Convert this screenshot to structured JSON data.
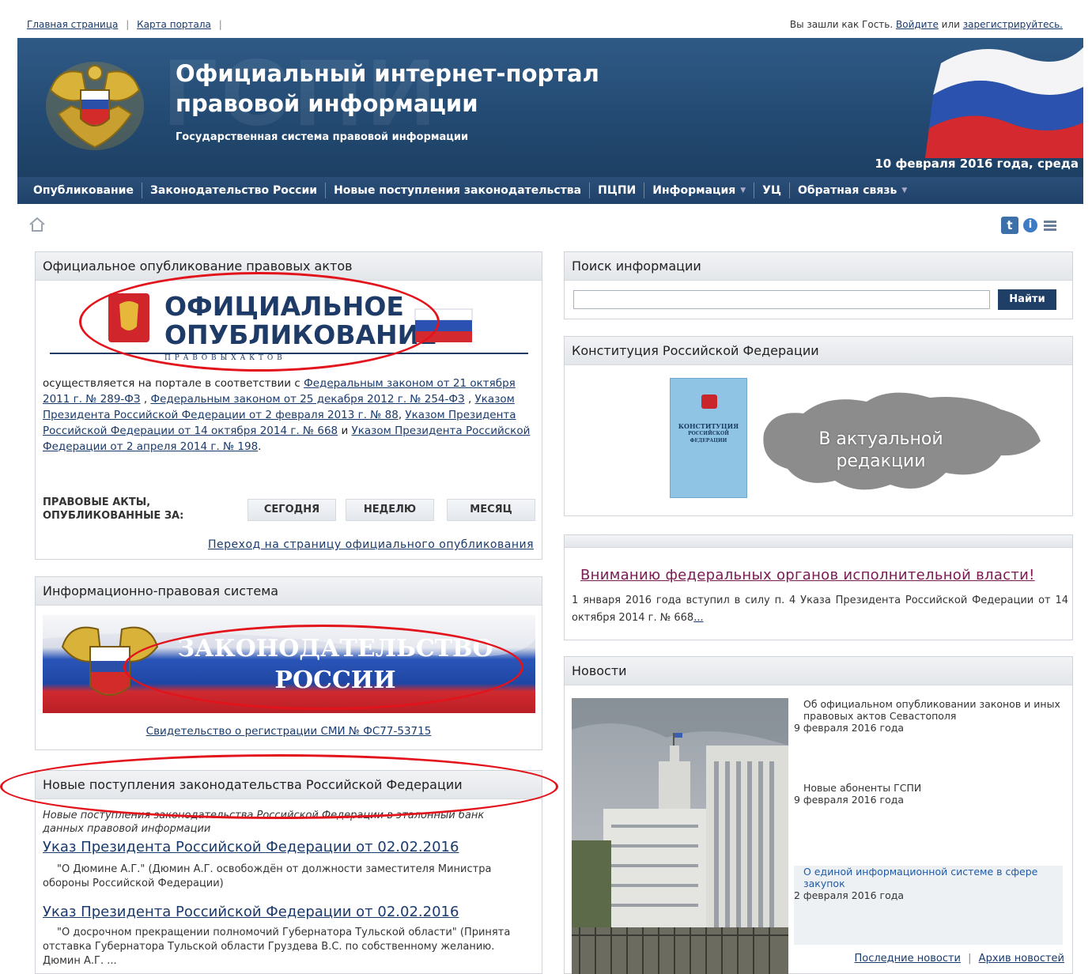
{
  "topbar": {
    "home_link": "Главная страница",
    "map_link": "Карта портала",
    "separator": "|",
    "guest_prefix": "Вы зашли как Гость.",
    "login_link": "Войдите",
    "or_text": "или",
    "register_link": "зарегистрируйтесь."
  },
  "header": {
    "watermark": "ГСПИ",
    "title_line1": "Официальный интернет-портал",
    "title_line2": "правовой информации",
    "subtitle": "Государственная система правовой информации",
    "date": "10 февраля 2016 года, среда"
  },
  "nav": {
    "items": [
      {
        "label": "Опубликование",
        "dropdown": false
      },
      {
        "label": "Законодательство России",
        "dropdown": false
      },
      {
        "label": "Новые поступления законодательства",
        "dropdown": false
      },
      {
        "label": "ПЦПИ",
        "dropdown": false
      },
      {
        "label": "Информация",
        "dropdown": true
      },
      {
        "label": "УЦ",
        "dropdown": false
      },
      {
        "label": "Обратная связь",
        "dropdown": true
      }
    ]
  },
  "toolbar": {
    "twitter_glyph": "t",
    "info_glyph": "i"
  },
  "pub_panel": {
    "heading": "Официальное опубликование правовых актов",
    "logo_line1": "ОФИЦИАЛЬНОЕ",
    "logo_line2": "ОПУБЛИКОВАНИЕ",
    "logo_line3": "П Р А В О В Ы Х   А К Т О В",
    "text_prefix": "осуществляется на портале в соответствии с ",
    "link1": "Федеральным законом от 21 октября 2011 г. № 289-ФЗ",
    "sep1": " , ",
    "link2": "Федеральным законом от 25 декабря 2012 г. № 254-ФЗ",
    "sep2": " , ",
    "link3": "Указом Президента Российской Федерации от 2 февраля 2013 г. № 88",
    "sep3": ", ",
    "link4": "Указом Президента Российской Федерации от 14 октября 2014 г. № 668",
    "sep4": " и ",
    "link5": "Указом Президента Российской Федерации от 2 апреля 2014 г. № 198",
    "text_suffix": ".",
    "acts_label_line1": "ПРАВОВЫЕ АКТЫ,",
    "acts_label_line2": "ОПУБЛИКОВАННЫЕ ЗА:",
    "btn_today": "СЕГОДНЯ",
    "btn_week": "НЕДЕЛЮ",
    "btn_month": "МЕСЯЦ",
    "goto_link": "Переход на страницу официального опубликования"
  },
  "ips_panel": {
    "heading": "Информационно-правовая система",
    "banner_line1": "ЗАКОНОДАТЕЛЬСТВО",
    "banner_line2": "РОССИИ",
    "cert_link": "Свидетельство о регистрации СМИ № ФС77-53715"
  },
  "new_panel": {
    "heading": "Новые поступления законодательства Российской Федерации",
    "intro": "Новые поступления законодательства Российской Федерации в эталонный банк данных правовой информации",
    "items": [
      {
        "title": "Указ Президента Российской Федерации от 02.02.2016",
        "desc": "\"О Дюмине А.Г.\" (Дюмин А.Г. освобождён от должности заместителя Министра обороны Российской Федерации)"
      },
      {
        "title": "Указ Президента Российской Федерации от 02.02.2016",
        "desc": "\"О досрочном прекращении полномочий Губернатора Тульской области\" (Принята отставка Губернатора Тульской области Груздева В.С. по собственному желанию. Дюмин А.Г. ..."
      }
    ]
  },
  "search_panel": {
    "heading": "Поиск информации",
    "input_value": "",
    "button": "Найти"
  },
  "const_panel": {
    "heading": "Конституция Российской Федерации",
    "book_title_line1": "КОНСТИТУЦИЯ",
    "book_title_line2": "РОССИЙСКОЙ",
    "book_title_line3": "ФЕДЕРАЦИИ",
    "map_line1": "В актуальной",
    "map_line2": "редакции"
  },
  "notice_panel": {
    "title": "Вниманию федеральных органов исполнительной власти!",
    "body": "1 января 2016 года вступил в силу п. 4 Указа Президента Российской Федерации от 14 октября 2014 г. № 668",
    "more_link": "..."
  },
  "news_panel": {
    "heading": "Новости",
    "items": [
      {
        "title": "Об официальном опубликовании законов и иных правовых актов Севастополя",
        "date": "9 февраля 2016 года"
      },
      {
        "title": "Новые абоненты ГСПИ",
        "date": "9 февраля 2016 года"
      },
      {
        "title": "О единой информационной системе в сфере закупок",
        "date": "2 февраля 2016 года"
      }
    ],
    "latest_link": "Последние новости",
    "sep": "|",
    "archive_link": "Архив новостей"
  },
  "colors": {
    "header_blue": "#234a72",
    "nav_blue": "#1f416a",
    "link_blue": "#1a3a6b",
    "notice_purple": "#7a1a52",
    "annotation_red": "#e3131b"
  }
}
